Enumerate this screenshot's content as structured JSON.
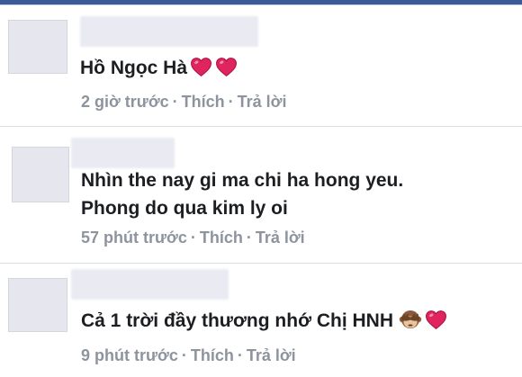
{
  "comments": [
    {
      "text": "Hồ Ngọc Hà",
      "time": "2 giờ trước",
      "like": "Thích",
      "reply": "Trả lời",
      "emoji": [
        "heart-icon",
        "heart-icon"
      ]
    },
    {
      "text_line1": "Nhìn the nay gi ma chi ha hong yeu.",
      "text_line2": "Phong do qua kim ly oi",
      "time": "57 phút trước",
      "like": "Thích",
      "reply": "Trả lời"
    },
    {
      "text": "Cả 1 trời đầy thương nhớ Chị HNH",
      "time": "9 phút trước",
      "like": "Thích",
      "reply": "Trả lời",
      "emoji": [
        "see-no-evil-monkey-icon",
        "heart-icon"
      ]
    }
  ],
  "separator": "·",
  "colors": {
    "header": "#3b5998",
    "meta": "#8d949e",
    "heart": "#e0245e"
  }
}
